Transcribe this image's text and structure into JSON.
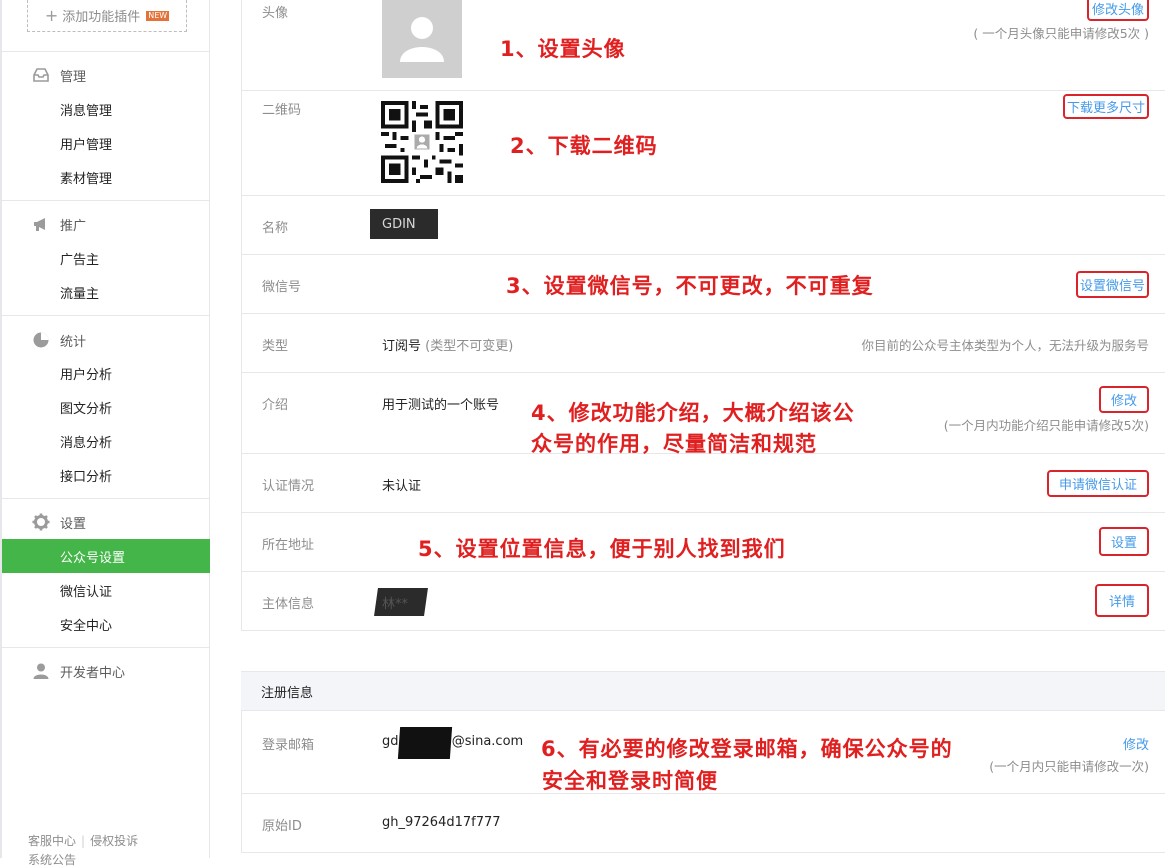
{
  "sidebar": {
    "plugin_button": {
      "label": "添加功能插件",
      "badge": "NEW"
    },
    "groups": [
      {
        "title": "管理",
        "icon": "inbox-icon",
        "items": [
          "消息管理",
          "用户管理",
          "素材管理"
        ]
      },
      {
        "title": "推广",
        "icon": "megaphone-icon",
        "items": [
          "广告主",
          "流量主"
        ]
      },
      {
        "title": "统计",
        "icon": "pie-chart-icon",
        "items": [
          "用户分析",
          "图文分析",
          "消息分析",
          "接口分析"
        ]
      },
      {
        "title": "设置",
        "icon": "gear-icon",
        "items": [
          "公众号设置",
          "微信认证",
          "安全中心"
        ]
      },
      {
        "title": "开发者中心",
        "icon": "user-icon",
        "items": []
      }
    ],
    "active_item": "公众号设置",
    "footer": {
      "link1": "客服中心",
      "link2": "侵权投诉",
      "link3": "系统公告"
    }
  },
  "colors": {
    "accent_green": "#44b549",
    "link_blue": "#459ae9",
    "annotation_red": "#e02020"
  },
  "account_info": {
    "avatar": {
      "label": "头像",
      "action": "修改头像",
      "note": "( 一个月头像只能申请修改5次 )"
    },
    "qrcode": {
      "label": "二维码",
      "action": "下载更多尺寸"
    },
    "name": {
      "label": "名称",
      "value": "GDIN"
    },
    "wechat_id": {
      "label": "微信号",
      "action": "设置微信号"
    },
    "type": {
      "label": "类型",
      "value": "订阅号",
      "value_note": "(类型不可变更)",
      "note": "你目前的公众号主体类型为个人，无法升级为服务号"
    },
    "intro": {
      "label": "介绍",
      "value": "用于测试的一个账号",
      "action": "修改",
      "note": "(一个月内功能介绍只能申请修改5次)"
    },
    "verification": {
      "label": "认证情况",
      "value": "未认证",
      "action": "申请微信认证"
    },
    "location": {
      "label": "所在地址",
      "action": "设置"
    },
    "entity": {
      "label": "主体信息",
      "value": "林**",
      "action": "详情"
    }
  },
  "registration": {
    "section_title": "注册信息",
    "email": {
      "label": "登录邮箱",
      "value": "gdin12345@sina.com",
      "action": "修改",
      "note": "(一个月内只能申请修改一次)"
    },
    "original_id": {
      "label": "原始ID",
      "value": "gh_97264d17f777"
    }
  },
  "annotations": {
    "a1": "1、设置头像",
    "a2": "2、下载二维码",
    "a3": "3、设置微信号，不可更改，不可重复",
    "a4_line1": "4、修改功能介绍，大概介绍该公",
    "a4_line2": "众号的作用，尽量简洁和规范",
    "a5": "5、设置位置信息，便于别人找到我们",
    "a6_line1": "6、有必要的修改登录邮箱，确保公众号的",
    "a6_line2": "安全和登录时简便"
  }
}
